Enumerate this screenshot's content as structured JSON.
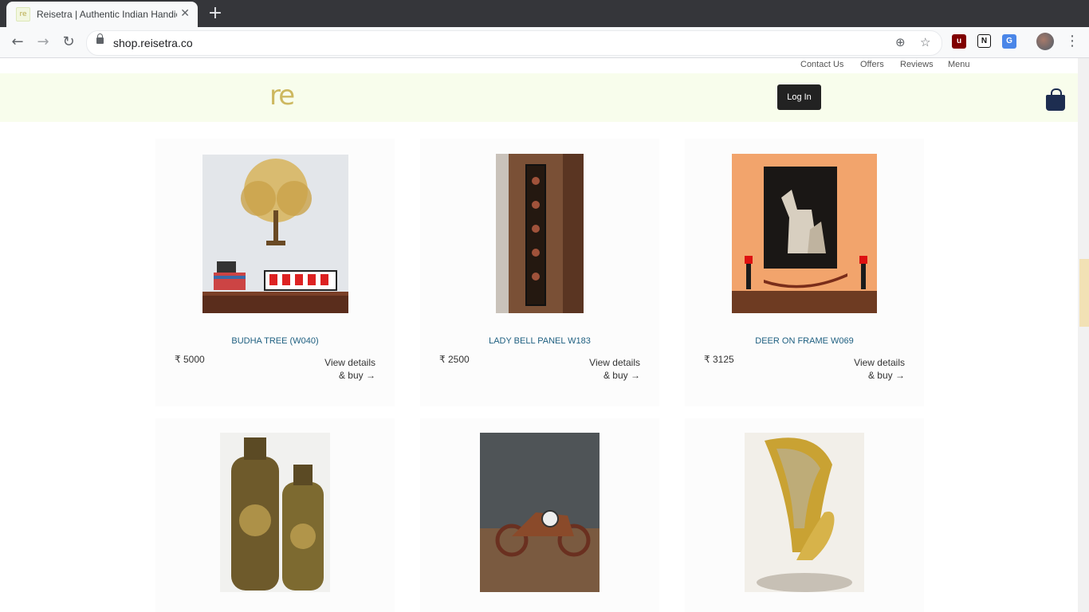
{
  "browser": {
    "tab_title": "Reisetra | Authentic Indian Handicrafts",
    "favicon_text": "re",
    "new_tab": "+",
    "url": "shop.reisetra.co"
  },
  "topnav": {
    "contact": "Contact Us",
    "offers": "Offers",
    "reviews": "Reviews",
    "menu": "Menu"
  },
  "header": {
    "logo": "re",
    "login": "Log In"
  },
  "products": [
    {
      "name": "BUDHA TREE (W040)",
      "price": "₹ 5000",
      "cta_line1": "View details",
      "cta_line2": "& buy →"
    },
    {
      "name": "LADY BELL PANEL W183",
      "price": "₹ 2500",
      "cta_line1": "View details",
      "cta_line2": "& buy →"
    },
    {
      "name": "DEER ON FRAME W069",
      "price": "₹ 3125",
      "cta_line1": "View details",
      "cta_line2": "& buy →"
    }
  ],
  "colors": {
    "header_bg": "#f8fdec",
    "logo": "#cdb860",
    "product_link": "#1e5f80",
    "bag": "#1d2d50"
  }
}
